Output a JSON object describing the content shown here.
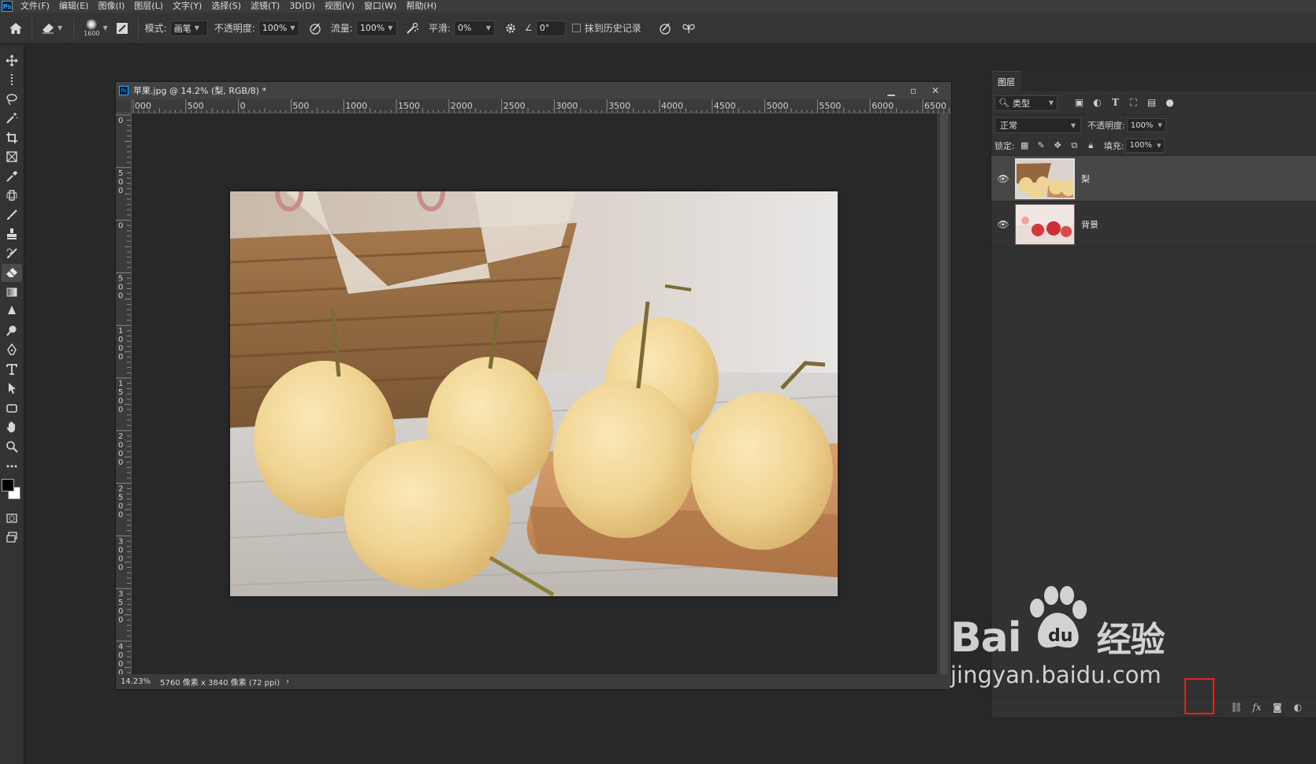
{
  "app": {
    "logo": "Ps"
  },
  "menu": [
    "文件(F)",
    "编辑(E)",
    "图像(I)",
    "图层(L)",
    "文字(Y)",
    "选择(S)",
    "滤镜(T)",
    "3D(D)",
    "视图(V)",
    "窗口(W)",
    "帮助(H)"
  ],
  "options": {
    "brush_size": "1600",
    "mode_label": "模式:",
    "mode_value": "画笔",
    "opacity_label": "不透明度:",
    "opacity_value": "100%",
    "flow_label": "流量:",
    "flow_value": "100%",
    "smoothing_label": "平滑:",
    "smoothing_value": "0%",
    "angle_value": "0°",
    "erase_history_label": "抹到历史记录"
  },
  "document": {
    "title": "苹果.jpg @ 14.2% (梨, RGB/8) *",
    "zoom": "14.23%",
    "info": "5760 像素 x 3840 像素 (72 ppi)",
    "status_arrow": "›",
    "ruler_h": [
      "000",
      "500",
      "0",
      "500",
      "1000",
      "1500",
      "2000",
      "2500",
      "3000",
      "3500",
      "4000",
      "4500",
      "5000",
      "5500",
      "6000",
      "6500"
    ],
    "ruler_v": [
      "0",
      "500",
      "0",
      "500",
      "1000",
      "1500",
      "2000",
      "2500",
      "3000",
      "3500",
      "4000",
      "4"
    ]
  },
  "layers_panel": {
    "tab": "图层",
    "filter_label": "类型",
    "blend_mode": "正常",
    "opacity_label": "不透明度:",
    "opacity_value": "100%",
    "lock_label": "锁定:",
    "fill_label": "填充:",
    "fill_value": "100%",
    "layers": [
      {
        "name": "梨",
        "selected": true
      },
      {
        "name": "背景",
        "selected": false
      }
    ]
  },
  "watermark": {
    "brand": "Bai",
    "brand_cn": "经验",
    "url": "jingyan.baidu.com"
  },
  "colors": {
    "accent": "#31a8ff",
    "highlight_box": "#e52222",
    "panel_bg": "#323232"
  }
}
